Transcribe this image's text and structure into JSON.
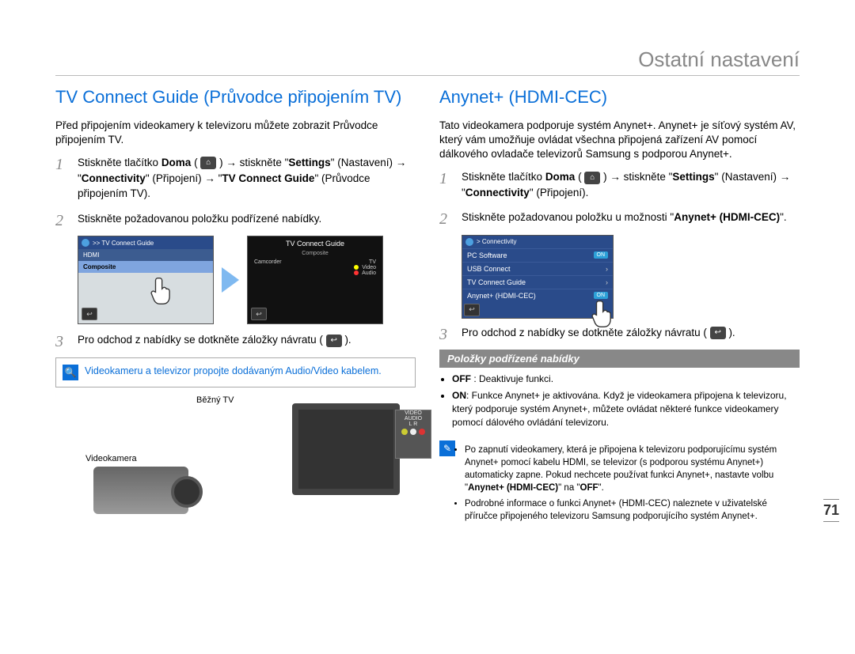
{
  "chapter_title": "Ostatní nastavení",
  "page_number": "71",
  "left": {
    "heading": "TV Connect Guide (Průvodce připojením TV)",
    "intro": "Před připojením videokamery k televizoru můžete zobrazit Průvodce připojením TV.",
    "step1_a": "Stiskněte tlačítko ",
    "step1_b": "Doma",
    "step1_c": " ( ",
    "step1_home": "⌂",
    "step1_d": " ) → stiskněte \"",
    "step1_e": "Settings",
    "step1_f": "\" (Nastavení) → \"",
    "step1_g": "Connectivity",
    "step1_h": "\" (Připojení) → \"",
    "step1_i": "TV Connect Guide",
    "step1_j": "\" (Průvodce připojením TV).",
    "step2": "Stiskněte požadovanou položku podřízené nabídky.",
    "step3_a": "Pro odchod z nabídky se dotkněte záložky návratu ( ",
    "step3_b": " ).",
    "screen1": {
      "breadcrumb": ">> TV Connect Guide",
      "item1": "HDMI",
      "item2": "Composite"
    },
    "screen2": {
      "title": "TV Connect Guide",
      "subtitle": "Composite",
      "left_label": "Camcorder",
      "right_label1": "TV",
      "right_video": "Video",
      "right_audio": "Audio"
    },
    "note": "Videokameru a televizor propojte dodávaným Audio/Video kabelem.",
    "diagram": {
      "tv_label": "Běžný TV",
      "cam_label": "Videokamera",
      "panel_video": "VIDEO",
      "panel_audio": "AUDIO",
      "panel_l": "L",
      "panel_r": "R"
    },
    "return_icon": "↩"
  },
  "right": {
    "heading": "Anynet+ (HDMI-CEC)",
    "intro": "Tato videokamera podporuje systém Anynet+. Anynet+ je síťový systém AV, který vám umožňuje ovládat všechna připojená zařízení AV pomocí dálkového ovladače televizorů Samsung s podporou Anynet+.",
    "step1_a": "Stiskněte tlačítko ",
    "step1_b": "Doma",
    "step1_c": " ( ",
    "step1_home": "⌂",
    "step1_d": " ) → stiskněte \"",
    "step1_e": "Settings",
    "step1_f": "\" (Nastavení) → \"",
    "step1_g": "Connectivity",
    "step1_h": "\" (Připojení).",
    "step2_a": "Stiskněte požadovanou položku u možnosti \"",
    "step2_b": "Anynet+ (HDMI-CEC)",
    "step2_c": "\".",
    "step3_a": "Pro odchod z nabídky se dotkněte záložky návratu ( ",
    "step3_b": " ).",
    "conn_screen": {
      "breadcrumb": "> Connectivity",
      "r1": "PC Software",
      "r1v": "ON",
      "r2": "USB Connect",
      "r3": "TV Connect Guide",
      "r4": "Anynet+ (HDMI-CEC)",
      "r4v": "ON"
    },
    "submenu_heading": "Položky podřízené nabídky",
    "off_label": "OFF",
    "off_text": " : Deaktivuje funkci.",
    "on_label": "ON",
    "on_text": ": Funkce Anynet+ je aktivována. Když je videokamera připojena k televizoru, který podporuje systém Anynet+, můžete ovládat některé funkce videokamery pomocí dálového ovládání televizoru.",
    "info1_a": "Po zapnutí videokamery, která je připojena k televizoru podporujícímu systém Anynet+ pomocí kabelu HDMI, se televizor (s podporou systému Anynet+) automaticky zapne. Pokud nechcete používat funkci Anynet+, nastavte volbu \"",
    "info1_b": "Anynet+ (HDMI-CEC)",
    "info1_c": "\" na \"",
    "info1_d": "OFF",
    "info1_e": "\".",
    "info2": "Podrobné informace o funkci Anynet+ (HDMI-CEC) naleznete v uživatelské příručce připojeného televizoru Samsung podporujícího systém Anynet+.",
    "return_icon": "↩"
  }
}
